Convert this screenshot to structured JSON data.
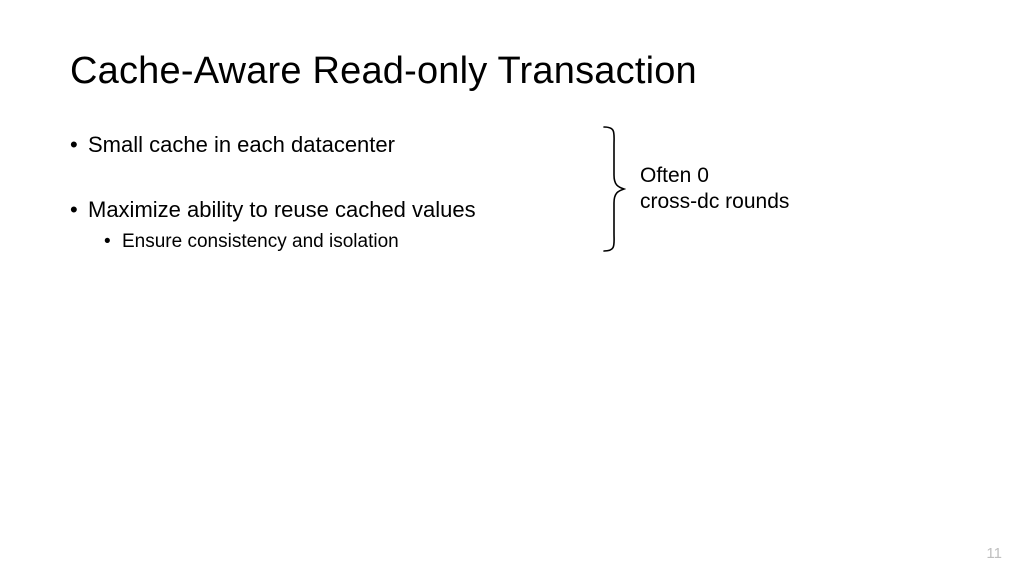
{
  "title": "Cache-Aware Read-only Transaction",
  "bullets": {
    "b1": "Small cache in each datacenter",
    "b2": "Maximize ability to reuse cached values",
    "b2_sub1": "Ensure consistency and isolation"
  },
  "annotation": {
    "line1": "Often 0",
    "line2": "cross-dc rounds"
  },
  "page_number": "11"
}
